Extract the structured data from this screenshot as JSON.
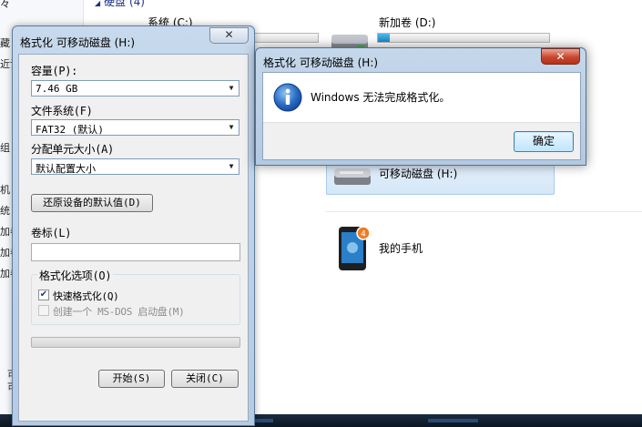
{
  "explorer": {
    "group_header": "硬盘 (4)",
    "nav_fragments": [
      "々",
      "藏",
      "近访",
      "组",
      "机",
      "统",
      "加卷",
      "加卷",
      "加卷"
    ],
    "drives": [
      {
        "label": "系统 (C:)",
        "used_fraction": 0.3
      },
      {
        "label": "新加卷 (D:)",
        "used_fraction": 0.07
      }
    ],
    "removable_drive": "可移动磁盘 (H:)",
    "phone": {
      "label": "我的手机",
      "badge": "4"
    },
    "bottom_left": [
      "可",
      "可"
    ]
  },
  "format_dialog": {
    "title": "格式化 可移动磁盘 (H:)",
    "close_label": "✕",
    "capacity_label": "容量(P):",
    "capacity_value": "7.46 GB",
    "filesystem_label": "文件系统(F)",
    "filesystem_value": "FAT32 (默认)",
    "allocation_label": "分配单元大小(A)",
    "allocation_value": "默认配置大小",
    "restore_defaults_label": "还原设备的默认值(D)",
    "volume_label_label": "卷标(L)",
    "volume_label_value": "",
    "options_label": "格式化选项(O)",
    "quick_format_label": "快速格式化(Q)",
    "quick_format_checked": true,
    "msdos_label": "创建一个 MS-DOS 启动盘(M)",
    "msdos_checked": false,
    "progress": 0,
    "start_label": "开始(S)",
    "close_button_label": "关闭(C)"
  },
  "message_box": {
    "title": "格式化 可移动磁盘 (H:)",
    "close_label": "✕",
    "message": "Windows 无法完成格式化。",
    "icon": "info-icon",
    "ok_label": "确定"
  },
  "colors": {
    "title_close_red": "#c9462e",
    "drive_fill": "#1b86c9",
    "accent_blue": "#1e3287"
  }
}
